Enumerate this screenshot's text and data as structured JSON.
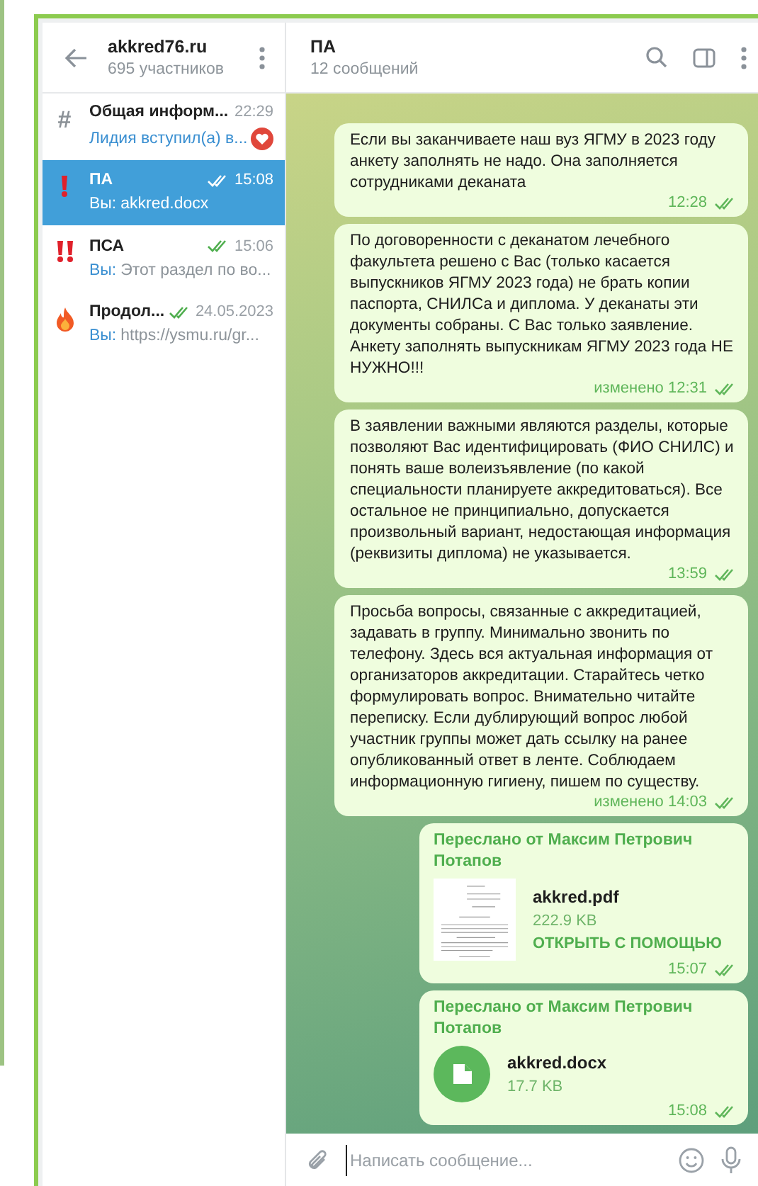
{
  "sidebar": {
    "title": "akkred76.ru",
    "subtitle": "695 участников",
    "chats": [
      {
        "kind": "symbol",
        "symbol": "#",
        "name": "Общая информ...",
        "time": "22:29",
        "read": false,
        "preview": "Лидия вступил(а) в...",
        "service": true,
        "heart_reaction": true,
        "selected": false
      },
      {
        "kind": "exclaim",
        "name": "ПА",
        "time": "15:08",
        "read": true,
        "sender": "Вы:",
        "preview": "akkred.docx",
        "service": false,
        "heart_reaction": false,
        "selected": true
      },
      {
        "kind": "double_exclaim",
        "name": "ПСА",
        "time": "15:06",
        "read": true,
        "sender": "Вы:",
        "preview": "Этот раздел по во...",
        "service": false,
        "heart_reaction": false,
        "selected": false
      },
      {
        "kind": "fire",
        "name": "Продол...",
        "time": "24.05.2023",
        "read": true,
        "sender": "Вы:",
        "preview": "https://ysmu.ru/gr...",
        "service": false,
        "heart_reaction": false,
        "selected": false
      }
    ]
  },
  "chat": {
    "title": "ПА",
    "subtitle": "12 сообщений",
    "messages": [
      {
        "kind": "text",
        "text": "Если вы заканчиваете наш вуз ЯГМУ в 2023 году анкету заполнять не надо. Она заполняется сотрудниками деканата",
        "time": "12:28",
        "read": true
      },
      {
        "kind": "text",
        "text": "По договоренности с деканатом лечебного факультета решено с Вас (только касается выпускников ЯГМУ 2023 года) не брать копии паспорта, СНИЛСа и диплома. У деканаты эти документы собраны. С Вас только заявление. Анкету заполнять выпускникам ЯГМУ 2023 года НЕ НУЖНО!!!",
        "time": "изменено 12:31",
        "read": true
      },
      {
        "kind": "text",
        "text": "В заявлении важными являются разделы, которые позволяют Вас идентифицировать (ФИО СНИЛС) и понять ваше волеизъявление (по какой специальности планируете аккредитоваться). Все остальное не принципиально, допускается произвольный вариант, недостающая информация (реквизиты диплома) не указывается.",
        "time": "13:59",
        "read": true
      },
      {
        "kind": "text",
        "text": "Просьба вопросы, связанные с аккредитацией, задавать в группу. Минимально звонить по телефону. Здесь вся актуальная информация от организаторов аккредитации. Старайтесь четко формулировать вопрос. Внимательно читайте переписку. Если дублирующий вопрос любой участник группы может дать ссылку на ранее опубликованный ответ в ленте. Соблюдаем информационную гигиену, пишем  по существу.",
        "time": "изменено 14:03",
        "read": true
      },
      {
        "kind": "file_thumb",
        "forwarded": "Переслано от Максим Петрович Потапов",
        "file": "akkred.pdf",
        "size": "222.9 KB",
        "action": "ОТКРЫТЬ С ПОМОЩЬЮ",
        "time": "15:07",
        "read": true
      },
      {
        "kind": "file_icon",
        "forwarded": "Переслано от Максим Петрович Потапов",
        "file": "akkred.docx",
        "size": "17.7 KB",
        "time": "15:08",
        "read": true
      }
    ],
    "composer": {
      "placeholder": "Написать сообщение..."
    }
  }
}
